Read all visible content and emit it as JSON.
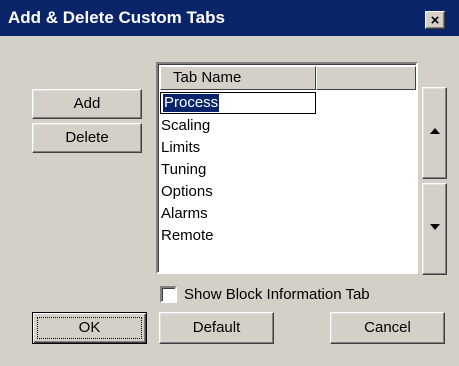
{
  "window": {
    "title": "Add & Delete Custom Tabs",
    "close_glyph": "×"
  },
  "buttons": {
    "add": "Add",
    "delete": "Delete",
    "ok": "OK",
    "default": "Default",
    "cancel": "Cancel"
  },
  "list": {
    "column_header": "Tab Name",
    "editing_value": "Process",
    "items": [
      "Scaling",
      "Limits",
      "Tuning",
      "Options",
      "Alarms",
      "Remote"
    ]
  },
  "checkbox": {
    "label": "Show Block Information Tab",
    "checked": false
  },
  "icons": {
    "up": "arrow-up-icon",
    "down": "arrow-down-icon"
  },
  "colors": {
    "titlebar": "#0a246a",
    "face": "#d4d0c8",
    "selection": "#0a246a"
  }
}
